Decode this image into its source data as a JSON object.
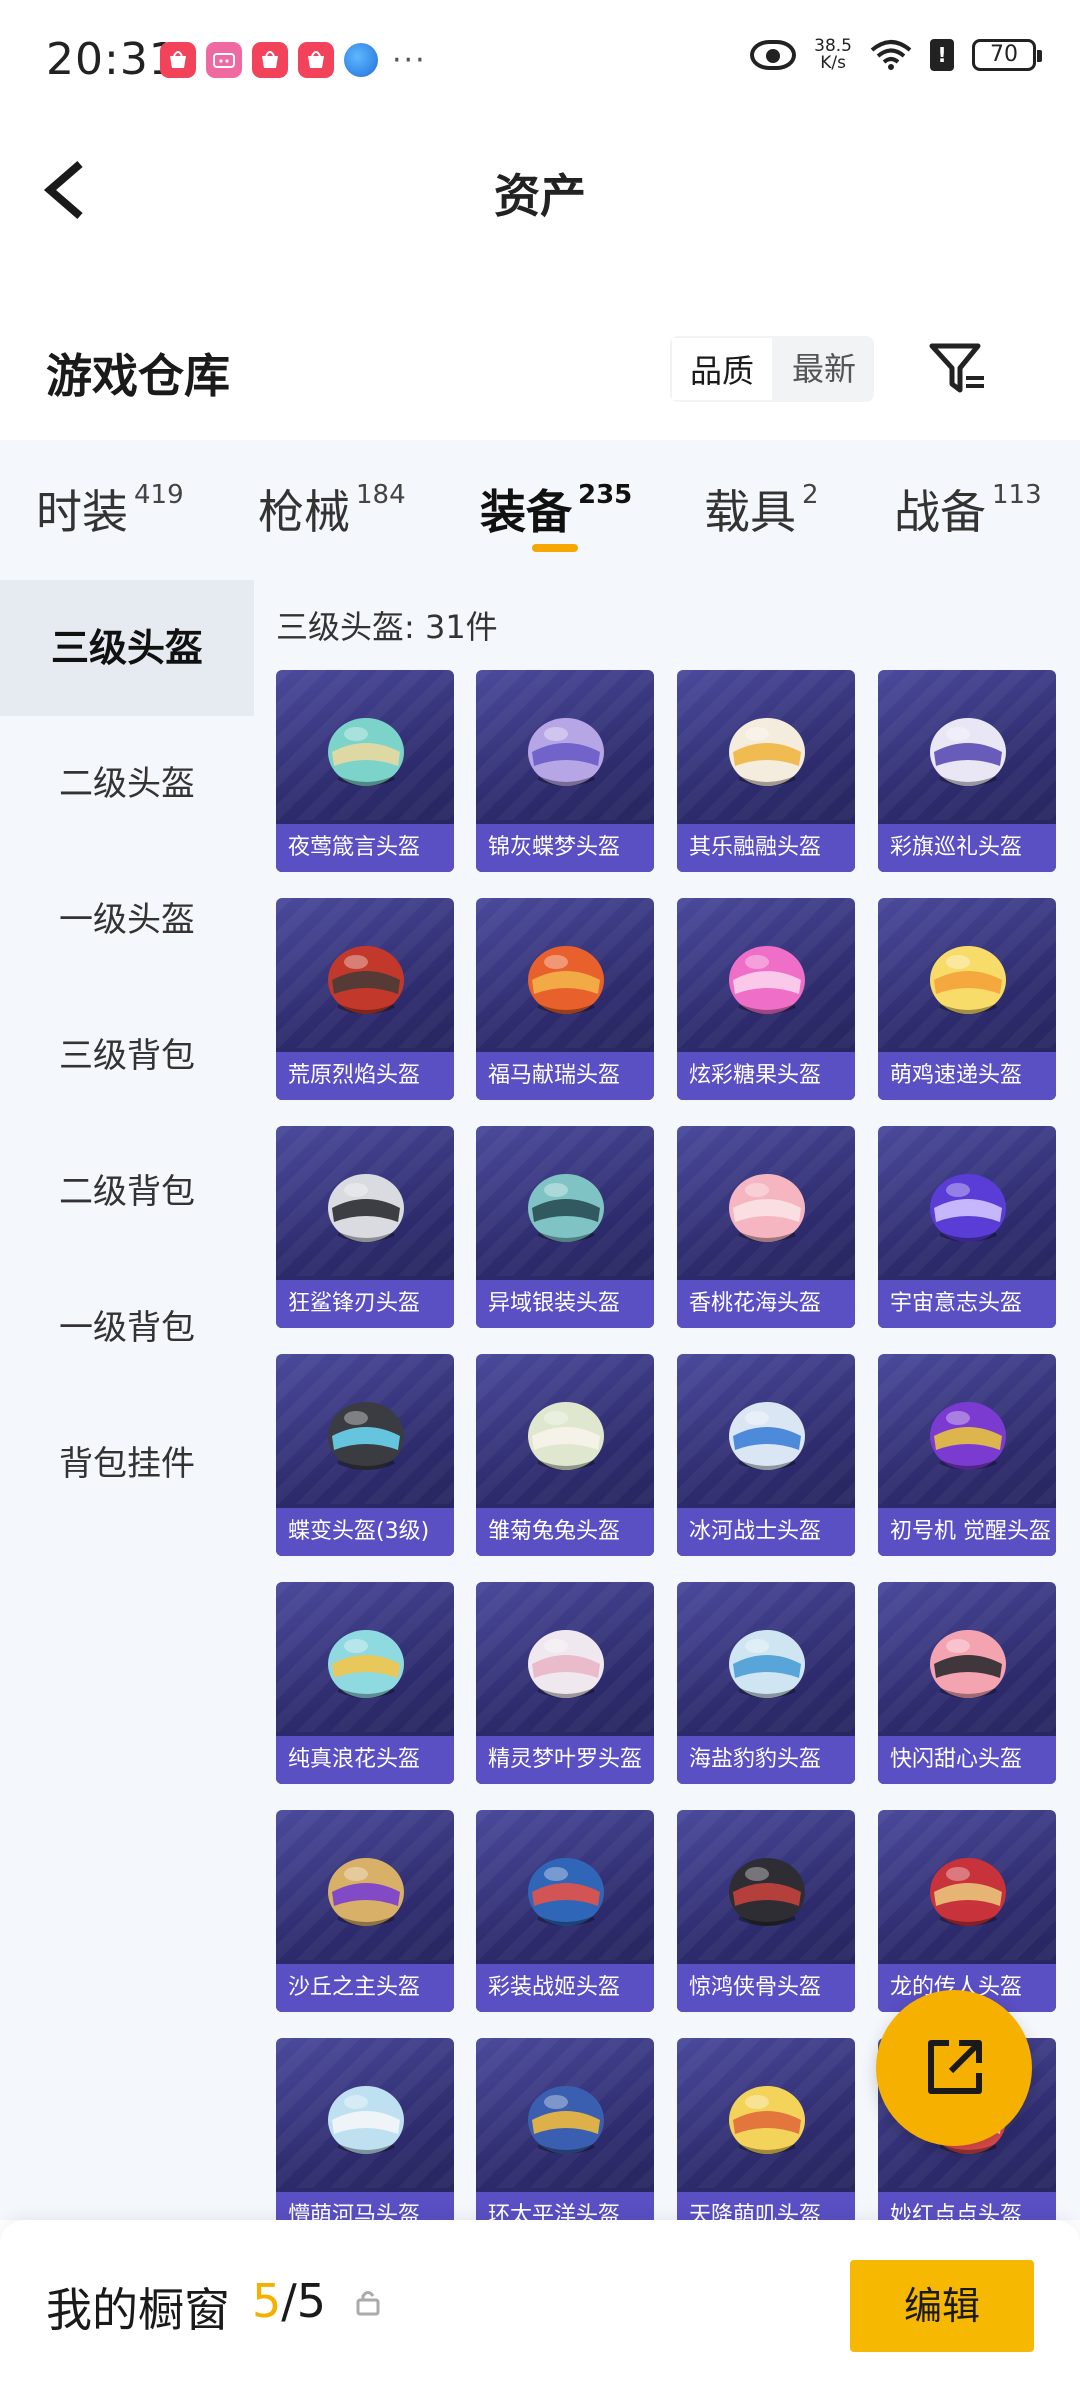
{
  "status_bar": {
    "time": "20:31",
    "app_icons": [
      "shop-icon",
      "bilibili-icon",
      "shop-icon",
      "shop-icon",
      "browser-icon"
    ],
    "more": "···",
    "net_speed_value": "38.5",
    "net_speed_unit": "K/s",
    "battery": "70"
  },
  "header": {
    "title": "资产"
  },
  "section": {
    "title": "游戏仓库",
    "sort_quality": "品质",
    "sort_latest": "最新"
  },
  "tabs": [
    {
      "label": "时装",
      "count": "419"
    },
    {
      "label": "枪械",
      "count": "184"
    },
    {
      "label": "装备",
      "count": "235",
      "active": true
    },
    {
      "label": "载具",
      "count": "2"
    },
    {
      "label": "战备",
      "count": "113"
    }
  ],
  "sidebar": [
    {
      "label": "三级头盔",
      "active": true
    },
    {
      "label": "二级头盔"
    },
    {
      "label": "一级头盔"
    },
    {
      "label": "三级背包"
    },
    {
      "label": "二级背包"
    },
    {
      "label": "一级背包"
    },
    {
      "label": "背包挂件"
    }
  ],
  "main": {
    "count_label": "三级头盔: 31件",
    "items": [
      {
        "name": "夜莺箴言头盔",
        "color": "#7bd3c9",
        "accent": "#e9d9a0"
      },
      {
        "name": "锦灰蝶梦头盔",
        "color": "#b7a6e6",
        "accent": "#6a5cc7"
      },
      {
        "name": "其乐融融头盔",
        "color": "#f4ecdc",
        "accent": "#f0b640"
      },
      {
        "name": "彩旗巡礼头盔",
        "color": "#e9e6f6",
        "accent": "#5a4bb3"
      },
      {
        "name": "荒原烈焰头盔",
        "color": "#c2392b",
        "accent": "#4a3b36"
      },
      {
        "name": "福马献瑞头盔",
        "color": "#e8612c",
        "accent": "#f3b24a"
      },
      {
        "name": "炫彩糖果头盔",
        "color": "#ef6fc8",
        "accent": "#fbd1ec"
      },
      {
        "name": "萌鸡速递头盔",
        "color": "#f8dc6a",
        "accent": "#f3a23a"
      },
      {
        "name": "狂鲨锋刃头盔",
        "color": "#d9dbe1",
        "accent": "#2b2b33"
      },
      {
        "name": "异域银装头盔",
        "color": "#7fc3c4",
        "accent": "#2a4e55"
      },
      {
        "name": "香桃花海头盔",
        "color": "#f6b6c1",
        "accent": "#fbe3e6"
      },
      {
        "name": "宇宙意志头盔",
        "color": "#5a3dd6",
        "accent": "#d2c3ff"
      },
      {
        "name": "蝶变头盔(3级)",
        "color": "#3a3c42",
        "accent": "#6bd4f0"
      },
      {
        "name": "雏菊兔兔头盔",
        "color": "#dfe8cf",
        "accent": "#f7f3ea"
      },
      {
        "name": "冰河战士头盔",
        "color": "#dbe6f4",
        "accent": "#3d7fd6"
      },
      {
        "name": "初号机 觉醒头盔",
        "color": "#7b3bd1",
        "accent": "#e7c33e"
      },
      {
        "name": "纯真浪花头盔",
        "color": "#8fd9e0",
        "accent": "#f2c54b"
      },
      {
        "name": "精灵梦叶罗头盔",
        "color": "#f0e8ef",
        "accent": "#e9b7c6"
      },
      {
        "name": "海盐豹豹头盔",
        "color": "#cfe6f2",
        "accent": "#4a9fd6"
      },
      {
        "name": "快闪甜心头盔",
        "color": "#f4a3b1",
        "accent": "#2b2b2f"
      },
      {
        "name": "沙丘之主头盔",
        "color": "#d8b067",
        "accent": "#7a3fd0"
      },
      {
        "name": "彩装战姬头盔",
        "color": "#2f66b8",
        "accent": "#e4524a"
      },
      {
        "name": "惊鸿侠骨头盔",
        "color": "#2d2d33",
        "accent": "#c4413c"
      },
      {
        "name": "龙的传人头盔",
        "color": "#c8323a",
        "accent": "#e9c37a"
      },
      {
        "name": "懵萌河马头盔",
        "color": "#bfe0f0",
        "accent": "#f3f6f8"
      },
      {
        "name": "环太平洋头盔",
        "color": "#3b5fb0",
        "accent": "#f0b93f"
      },
      {
        "name": "天降萌叽头盔",
        "color": "#f4d35a",
        "accent": "#e06b3a"
      },
      {
        "name": "妙红点点头盔",
        "color": "#e34d4d",
        "accent": "#f7e9d8"
      }
    ]
  },
  "bottom_bar": {
    "title": "我的橱窗",
    "count_current": "5",
    "count_sep": "/",
    "count_total": "5",
    "edit_label": "编辑"
  },
  "colors": {
    "accent": "#f6b000",
    "card_label": "#5a4fc3",
    "card_bg": "#2d2b6c",
    "page_bg": "#f4f7fb"
  }
}
